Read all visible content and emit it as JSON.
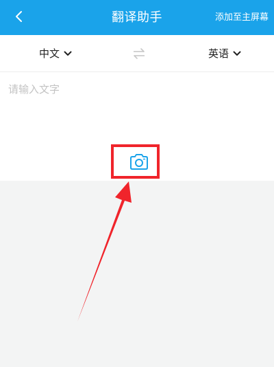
{
  "header": {
    "back_icon": "chevron-left-icon",
    "title": "翻译助手",
    "add_to_home": "添加至主屏幕",
    "background": "#1aa3ea"
  },
  "languages": {
    "source": "中文",
    "target": "英语",
    "swap_icon": "swap-arrows-icon"
  },
  "input": {
    "placeholder": "请输入文字",
    "value": "",
    "camera_icon": "camera-icon"
  },
  "annotation": {
    "color": "#f0242b"
  }
}
